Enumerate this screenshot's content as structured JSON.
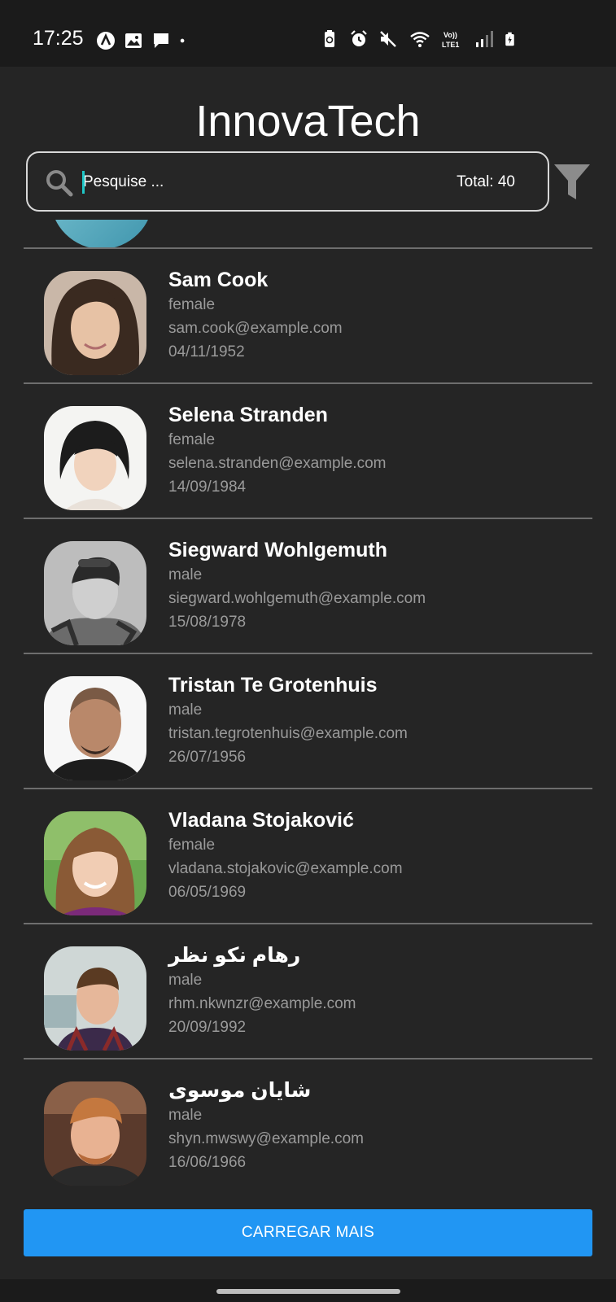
{
  "status_bar": {
    "time": "17:25",
    "icons_left": [
      "a-badge-icon",
      "image-icon",
      "chat-icon",
      "dot-icon"
    ],
    "icons_right": [
      "battery-saver-icon",
      "alarm-icon",
      "mute-icon",
      "wifi-icon",
      "volte-icon",
      "signal-icon",
      "battery-icon"
    ]
  },
  "header": {
    "title": "InnovaTech"
  },
  "search": {
    "placeholder": "Pesquise ...",
    "value": "",
    "total_label": "Total: 40"
  },
  "filter": {
    "icon": "filter-icon"
  },
  "users": [
    {
      "name": "Sam Cook",
      "gender": "female",
      "email": "sam.cook@example.com",
      "dob": "04/11/1952"
    },
    {
      "name": "Selena Stranden",
      "gender": "female",
      "email": "selena.stranden@example.com",
      "dob": "14/09/1984"
    },
    {
      "name": "Siegward Wohlgemuth",
      "gender": "male",
      "email": "siegward.wohlgemuth@example.com",
      "dob": "15/08/1978"
    },
    {
      "name": "Tristan Te Grotenhuis",
      "gender": "male",
      "email": "tristan.tegrotenhuis@example.com",
      "dob": "26/07/1956"
    },
    {
      "name": "Vladana Stojaković",
      "gender": "female",
      "email": "vladana.stojakovic@example.com",
      "dob": "06/05/1969"
    },
    {
      "name": "رهام نکو نظر",
      "gender": "male",
      "email": "rhm.nkwnzr@example.com",
      "dob": "20/09/1992"
    },
    {
      "name": "شایان موسوی",
      "gender": "male",
      "email": "shyn.mwswy@example.com",
      "dob": "16/06/1966"
    }
  ],
  "load_more": {
    "label": "CARREGAR MAIS"
  },
  "colors": {
    "background": "#252525",
    "accent": "#2196f3",
    "caret": "#1fc7c7",
    "divider": "#6e6e6e",
    "muted_text": "#9a9a9a"
  }
}
